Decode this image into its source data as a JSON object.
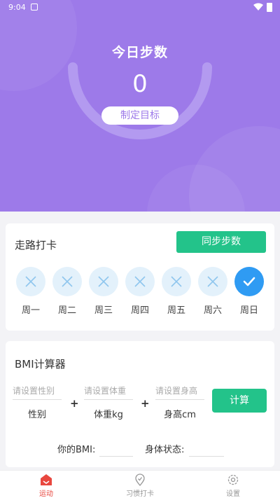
{
  "status_bar": {
    "time": "9:04"
  },
  "hero": {
    "title": "今日步数",
    "steps": "0",
    "goal_button": "制定目标"
  },
  "walk_card": {
    "title": "走路打卡",
    "sync_button": "同步步数",
    "days": [
      {
        "label": "周一",
        "checked": false
      },
      {
        "label": "周二",
        "checked": false
      },
      {
        "label": "周三",
        "checked": false
      },
      {
        "label": "周四",
        "checked": false
      },
      {
        "label": "周五",
        "checked": false
      },
      {
        "label": "周六",
        "checked": false
      },
      {
        "label": "周日",
        "checked": true
      }
    ]
  },
  "bmi_card": {
    "title": "BMI计算器",
    "gender": {
      "placeholder": "请设置性别",
      "label": "性别"
    },
    "weight": {
      "placeholder": "请设置体重",
      "label": "体重kg"
    },
    "height": {
      "placeholder": "请设置身高",
      "label": "身高cm"
    },
    "plus": "+",
    "calc_button": "计算",
    "bmi_label": "你的BMI:",
    "status_label": "身体状态:"
  },
  "tabs": [
    {
      "label": "运动",
      "active": true
    },
    {
      "label": "习惯打卡",
      "active": false
    },
    {
      "label": "设置",
      "active": false
    }
  ],
  "colors": {
    "hero_bg": "#9d7ae9",
    "accent_green": "#23c38a",
    "check_blue": "#2f9bf3",
    "unchecked_circle": "#e3f1fb",
    "active_tab": "#e8473f"
  }
}
